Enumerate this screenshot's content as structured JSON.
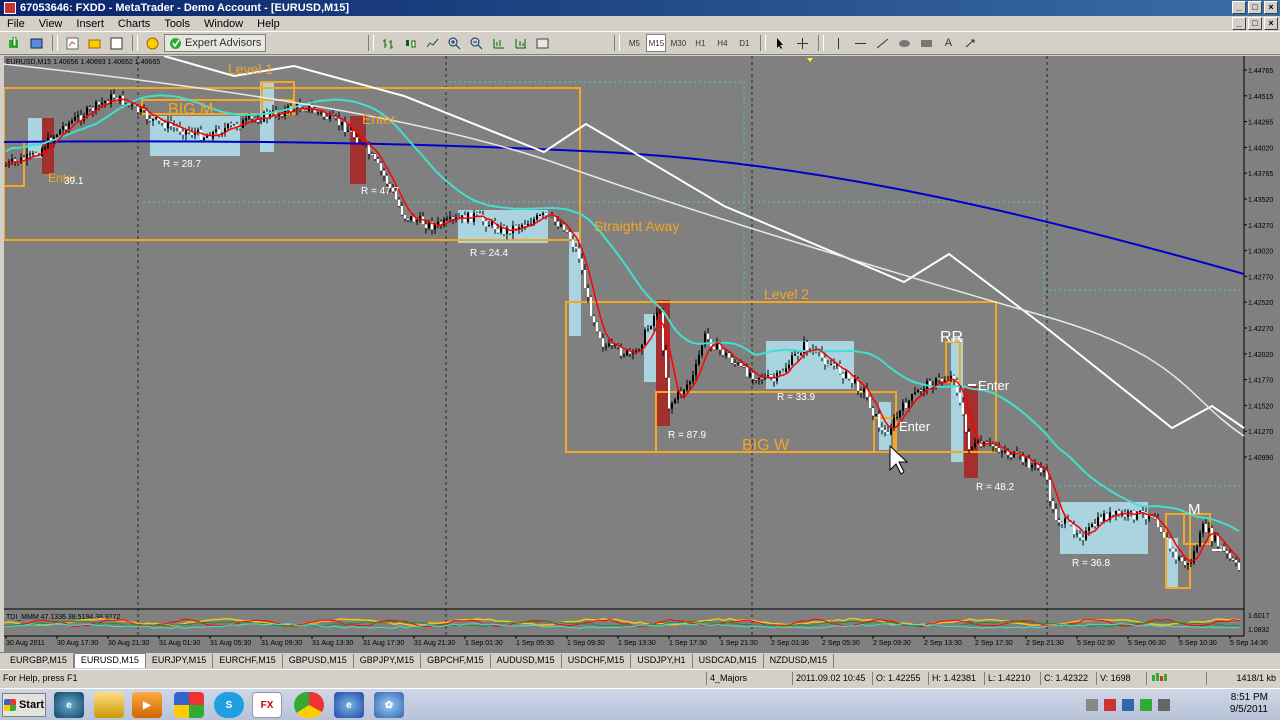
{
  "window": {
    "title": "67053646: FXDD - MetaTrader - Demo Account - [EURUSD,M15]",
    "buttons": [
      "_",
      "□",
      "×"
    ]
  },
  "menu": [
    "File",
    "View",
    "Insert",
    "Charts",
    "Tools",
    "Window",
    "Help"
  ],
  "toolbar": {
    "expert_advisors": "Expert Advisors",
    "periods": [
      "M5",
      "M15",
      "M30",
      "H1",
      "H4",
      "D1"
    ],
    "active_period": "M15",
    "text_tool": "A"
  },
  "chart": {
    "header": "EURUSD,M15  1.40656 1.40693 1.40652 1.40665",
    "indicator_header": "TDI_MMM 47.1336 38.5194 38.9272",
    "price_labels": [
      "1.44765",
      "1.44515",
      "1.44265",
      "1.44020",
      "1.43765",
      "1.43520",
      "1.43270",
      "1.43020",
      "1.42770",
      "1.42520",
      "1.42270",
      "1.42020",
      "1.41770",
      "1.41520",
      "1.41270",
      "1.40990"
    ],
    "indicator_labels": [
      "1.6017",
      "1.0832"
    ],
    "time_labels": [
      "30 Aug 2011",
      "30 Aug 17:30",
      "30 Aug 21:30",
      "31 Aug 01:30",
      "31 Aug 05:30",
      "31 Aug 09:30",
      "31 Aug 13:30",
      "31 Aug 17:30",
      "31 Aug 21:30",
      "1 Sep 01:30",
      "1 Sep 05:30",
      "1 Sep 09:30",
      "1 Sep 13:30",
      "1 Sep 17:30",
      "1 Sep 21:30",
      "2 Sep 01:30",
      "2 Sep 05:30",
      "2 Sep 09:30",
      "2 Sep 13:30",
      "2 Sep 17:30",
      "2 Sep 21:30",
      "5 Sep 02:30",
      "5 Sep 06:30",
      "5 Sep 10:30",
      "5 Sep 14:30"
    ],
    "annotations": {
      "level1": "Level 1",
      "big_m": "BIG  M",
      "enter1": "Enter",
      "enter_left": "Enter",
      "r_left": "39.1",
      "r1": "R = 28.7",
      "r2": "R = 47.7",
      "r3": "R = 24.4",
      "straight_away": "Straight Away",
      "level2": "Level 2",
      "rr": "RR",
      "enter2": "Enter",
      "enter3": "Enter",
      "r4": "R = 33.9",
      "r5": "R = 87.9",
      "big_w": "BIG  W",
      "r6": "R = 48.2",
      "m": "M",
      "r7": "R = 36.8"
    },
    "colors": {
      "background": "#808080",
      "bull_candle": "#000000",
      "orange": "#f5a623",
      "red_fill": "#a52a2a",
      "blue_fill": "#add8e6",
      "ma_cyan": "#40e0d0",
      "ma_red": "#ff0000",
      "ma_blue": "#0000cc",
      "white_line": "#ffffff"
    }
  },
  "symbol_tabs": [
    "EURGBP,M15",
    "EURUSD,M15",
    "EURJPY,M15",
    "EURCHF,M15",
    "GBPUSD,M15",
    "GBPJPY,M15",
    "GBPCHF,M15",
    "AUDUSD,M15",
    "USDCHF,M15",
    "USDJPY,H1",
    "USDCAD,M15",
    "NZDUSD,M15"
  ],
  "active_tab": "EURUSD,M15",
  "status": {
    "help": "For Help, press F1",
    "profile": "4_Majors",
    "datetime": "2011.09.02 10:45",
    "open": "O: 1.42255",
    "high": "H: 1.42381",
    "low": "L: 1.42210",
    "close": "C: 1.42322",
    "volume": "V: 1698",
    "traffic": "1418/1 kb"
  },
  "taskbar": {
    "start": "Start",
    "time": "8:51 PM",
    "date": "9/5/2011"
  }
}
